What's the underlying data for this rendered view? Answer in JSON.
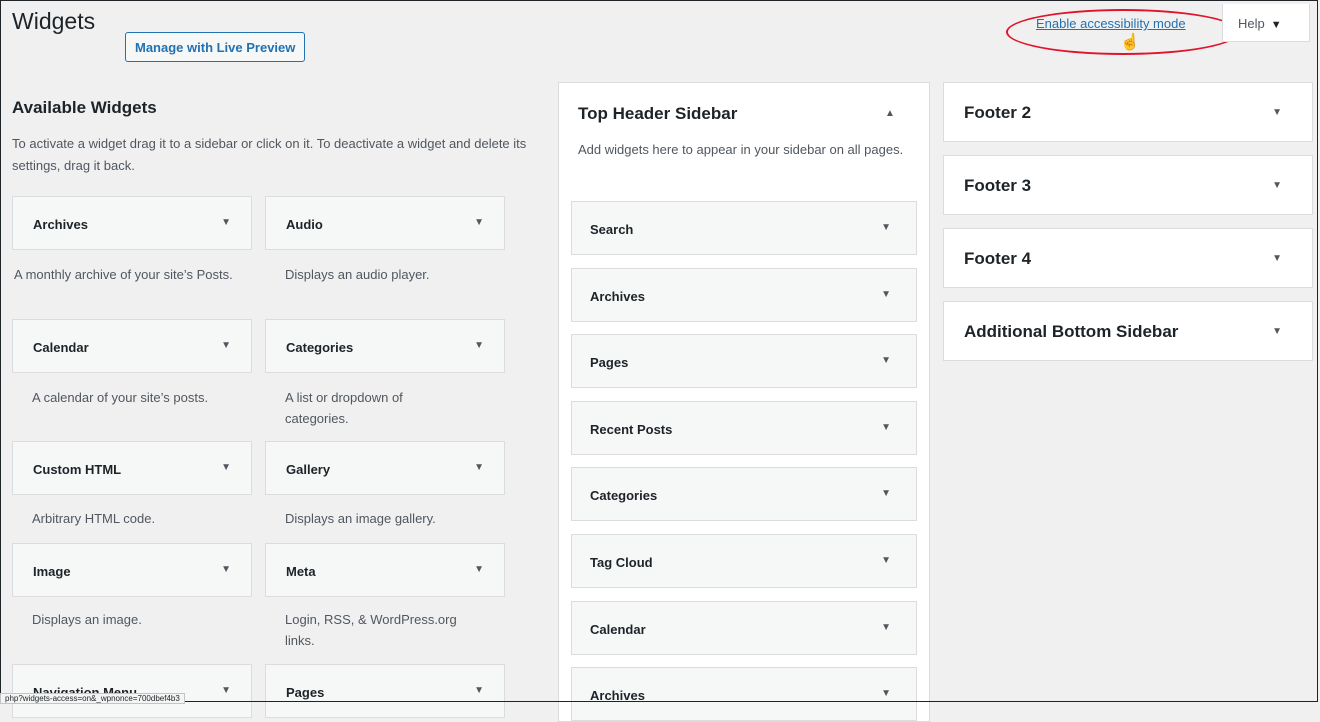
{
  "header": {
    "title": "Widgets",
    "live_preview_label": "Manage with Live Preview",
    "accessibility_link": "Enable accessibility mode",
    "help_label": "Help"
  },
  "available": {
    "heading": "Available Widgets",
    "description": "To activate a widget drag it to a sidebar or click on it. To deactivate a widget and delete its settings, drag it back.",
    "widgets": [
      {
        "name": "Archives",
        "desc": "A monthly archive of your site’s Posts."
      },
      {
        "name": "Audio",
        "desc": "Displays an audio player."
      },
      {
        "name": "Calendar",
        "desc": "A calendar of your site’s posts."
      },
      {
        "name": "Categories",
        "desc": "A list or dropdown of categories."
      },
      {
        "name": "Custom HTML",
        "desc": "Arbitrary HTML code."
      },
      {
        "name": "Gallery",
        "desc": "Displays an image gallery."
      },
      {
        "name": "Image",
        "desc": "Displays an image."
      },
      {
        "name": "Meta",
        "desc": "Login, RSS, & WordPress.org links."
      },
      {
        "name": "Navigation Menu",
        "desc": ""
      },
      {
        "name": "Pages",
        "desc": ""
      }
    ]
  },
  "top_header_sidebar": {
    "title": "Top Header Sidebar",
    "description": "Add widgets here to appear in your sidebar on all pages.",
    "widgets": [
      "Search",
      "Archives",
      "Pages",
      "Recent Posts",
      "Categories",
      "Tag Cloud",
      "Calendar",
      "Archives"
    ]
  },
  "other_sidebars": [
    "Footer 2",
    "Footer 3",
    "Footer 4",
    "Additional Bottom Sidebar"
  ],
  "status_bar": {
    "url": "php?widgets-access=on&_wpnonce=700dbef4b3"
  }
}
